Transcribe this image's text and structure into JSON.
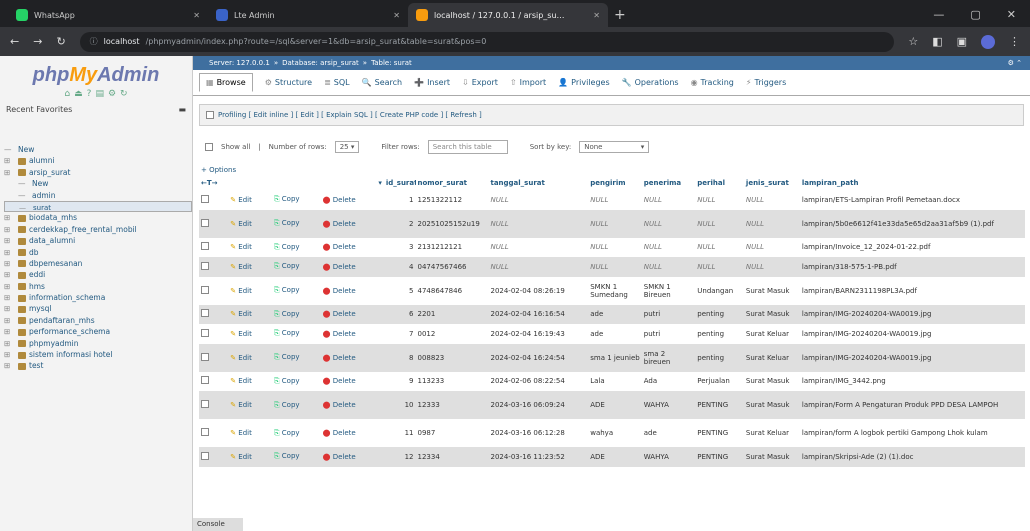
{
  "browser": {
    "tabs": [
      {
        "title": "WhatsApp",
        "color": "#25d366"
      },
      {
        "title": "Lte Admin",
        "color": "#3a63c8"
      },
      {
        "title": "localhost / 127.0.0.1 / arsip_su…",
        "color": "#f89c0e"
      }
    ],
    "url_host": "localhost",
    "url_path": "/phpmyadmin/index.php?route=/sql&server=1&db=arsip_surat&table=surat&pos=0"
  },
  "sidebar": {
    "logo_php": "php",
    "logo_my": "My",
    "logo_admin": "Admin",
    "recent": "Recent",
    "favorites": "Favorites",
    "tree": [
      {
        "label": "New",
        "level": 0,
        "db": false
      },
      {
        "label": "alumni",
        "level": 0,
        "db": true
      },
      {
        "label": "arsip_surat",
        "level": 0,
        "db": true
      },
      {
        "label": "New",
        "level": 1,
        "db": false
      },
      {
        "label": "admin",
        "level": 1,
        "db": false
      },
      {
        "label": "surat",
        "level": 1,
        "db": false,
        "selected": true
      },
      {
        "label": "biodata_mhs",
        "level": 0,
        "db": true
      },
      {
        "label": "cerdekkap_free_rental_mobil",
        "level": 0,
        "db": true
      },
      {
        "label": "data_alumni",
        "level": 0,
        "db": true
      },
      {
        "label": "db",
        "level": 0,
        "db": true
      },
      {
        "label": "dbpemesanan",
        "level": 0,
        "db": true
      },
      {
        "label": "eddi",
        "level": 0,
        "db": true
      },
      {
        "label": "hms",
        "level": 0,
        "db": true
      },
      {
        "label": "information_schema",
        "level": 0,
        "db": true
      },
      {
        "label": "mysql",
        "level": 0,
        "db": true
      },
      {
        "label": "pendaftaran_mhs",
        "level": 0,
        "db": true
      },
      {
        "label": "performance_schema",
        "level": 0,
        "db": true
      },
      {
        "label": "phpmyadmin",
        "level": 0,
        "db": true
      },
      {
        "label": "sistem informasi hotel",
        "level": 0,
        "db": true
      },
      {
        "label": "test",
        "level": 0,
        "db": true
      }
    ],
    "console": "Console"
  },
  "breadcrumb": [
    "Server: 127.0.0.1",
    "Database: arsip_surat",
    "Table: surat"
  ],
  "menu": [
    "Browse",
    "Structure",
    "SQL",
    "Search",
    "Insert",
    "Export",
    "Import",
    "Privileges",
    "Operations",
    "Tracking",
    "Triggers"
  ],
  "profiling": "Profiling [ Edit inline ] [ Edit ] [ Explain SQL ] [ Create PHP code ] [ Refresh ]",
  "filter": {
    "show_all": "Show all",
    "num_rows_label": "Number of rows:",
    "num_rows": "25",
    "filter_label": "Filter rows:",
    "filter_placeholder": "Search this table",
    "sort_label": "Sort by key:",
    "sort_value": "None"
  },
  "options_label": "+ Options",
  "table": {
    "headers": [
      "id_surat",
      "nomor_surat",
      "tanggal_surat",
      "pengirim",
      "penerima",
      "perihal",
      "jenis_surat",
      "lampiran_path"
    ],
    "actions": {
      "edit": "Edit",
      "copy": "Copy",
      "delete": "Delete"
    },
    "rows": [
      {
        "id": "1",
        "nomor": "1251322112",
        "tanggal": "NULL",
        "pengirim": "NULL",
        "penerima": "NULL",
        "perihal": "NULL",
        "jenis": "NULL",
        "lampiran": "lampiran/ETS-Lampiran Profil Pemetaan.docx"
      },
      {
        "id": "2",
        "nomor": "20251025152u19",
        "tanggal": "NULL",
        "pengirim": "NULL",
        "penerima": "NULL",
        "perihal": "NULL",
        "jenis": "NULL",
        "lampiran": "lampiran/5b0e6612f41e33da5e65d2aa31af5b9 (1).pdf",
        "tall": true
      },
      {
        "id": "3",
        "nomor": "2131212121",
        "tanggal": "NULL",
        "pengirim": "NULL",
        "penerima": "NULL",
        "perihal": "NULL",
        "jenis": "NULL",
        "lampiran": "lampiran/Invoice_12_2024-01-22.pdf"
      },
      {
        "id": "4",
        "nomor": "04747567466",
        "tanggal": "NULL",
        "pengirim": "NULL",
        "penerima": "NULL",
        "perihal": "NULL",
        "jenis": "NULL",
        "lampiran": "lampiran/318-575-1-PB.pdf"
      },
      {
        "id": "5",
        "nomor": "4748647846",
        "tanggal": "2024-02-04 08:26:19",
        "pengirim": "SMKN 1 Sumedang",
        "penerima": "SMKN 1 Bireuen",
        "perihal": "Undangan",
        "jenis": "Surat Masuk",
        "lampiran": "lampiran/BARN2311198PL3A.pdf",
        "tall": true
      },
      {
        "id": "6",
        "nomor": "2201",
        "tanggal": "2024-02-04 16:16:54",
        "pengirim": "ade",
        "penerima": "putri",
        "perihal": "penting",
        "jenis": "Surat Masuk",
        "lampiran": "lampiran/IMG-20240204-WA0019.jpg"
      },
      {
        "id": "7",
        "nomor": "0012",
        "tanggal": "2024-02-04 16:19:43",
        "pengirim": "ade",
        "penerima": "putri",
        "perihal": "penting",
        "jenis": "Surat Keluar",
        "lampiran": "lampiran/IMG-20240204-WA0019.jpg"
      },
      {
        "id": "8",
        "nomor": "008823",
        "tanggal": "2024-02-04 16:24:54",
        "pengirim": "sma 1 jeunieb",
        "penerima": "sma 2 bireuen",
        "perihal": "penting",
        "jenis": "Surat Keluar",
        "lampiran": "lampiran/IMG-20240204-WA0019.jpg",
        "tall": true
      },
      {
        "id": "9",
        "nomor": "113233",
        "tanggal": "2024-02-06 08:22:54",
        "pengirim": "Lala",
        "penerima": "Ada",
        "perihal": "Perjualan",
        "jenis": "Surat Masuk",
        "lampiran": "lampiran/IMG_3442.png"
      },
      {
        "id": "10",
        "nomor": "12333",
        "tanggal": "2024-03-16 06:09:24",
        "pengirim": "ADE",
        "penerima": "WAHYA",
        "perihal": "PENTING",
        "jenis": "Surat Masuk",
        "lampiran": "lampiran/Form A Pengaturan Produk PPD DESA LAMPOH",
        "tall": true
      },
      {
        "id": "11",
        "nomor": "0987",
        "tanggal": "2024-03-16 06:12:28",
        "pengirim": "wahya",
        "penerima": "ade",
        "perihal": "PENTING",
        "jenis": "Surat Keluar",
        "lampiran": "lampiran/form A logbok pertiki Gampong Lhok kulam",
        "tall": true
      },
      {
        "id": "12",
        "nomor": "12334",
        "tanggal": "2024-03-16 11:23:52",
        "pengirim": "ADE",
        "penerima": "WAHYA",
        "perihal": "PENTING",
        "jenis": "Surat Masuk",
        "lampiran": "lampiran/Skripsi-Ade (2) (1).doc"
      }
    ]
  }
}
